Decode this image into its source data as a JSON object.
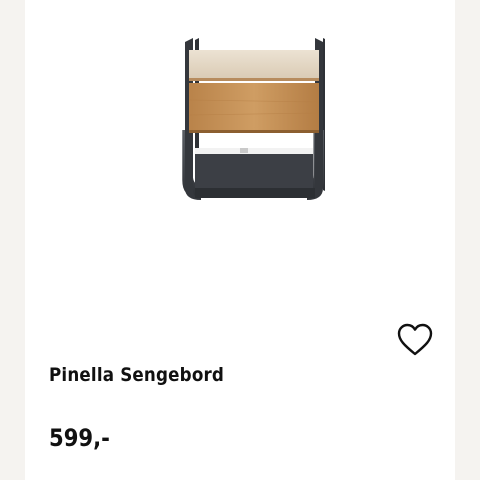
{
  "product": {
    "name": "Pinella Sengebord",
    "price": "599,-",
    "image_icon": "nightstand-image",
    "wishlist_icon": "heart-outline-icon"
  },
  "colors": {
    "page_background": "#f5f3f0",
    "card_background": "#ffffff",
    "text": "#111111",
    "wood": "#c8955a",
    "wood_top": "#e6dac8",
    "metal": "#3a3d42"
  }
}
